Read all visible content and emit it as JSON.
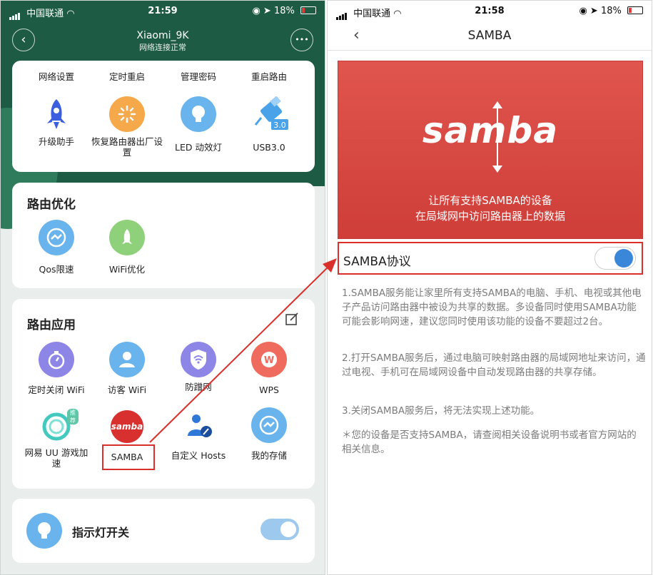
{
  "left": {
    "status": {
      "carrier": "中国联通",
      "time": "21:59",
      "battery": "18%"
    },
    "header": {
      "title": "Xiaomi_9K",
      "subtitle": "网络连接正常",
      "more": "•••",
      "back": "‹"
    },
    "top_labels": [
      "网络设置",
      "定时重启",
      "管理密码",
      "重启路由"
    ],
    "tools": [
      {
        "label": "升级助手",
        "icon": "rocket-icon"
      },
      {
        "label": "恢复路由器出厂设置",
        "icon": "reset-icon"
      },
      {
        "label": "LED 动效灯",
        "icon": "bulb-icon"
      },
      {
        "label": "USB3.0",
        "icon": "usb-icon",
        "badge": "3.0"
      }
    ],
    "optimize": {
      "title": "路由优化",
      "items": [
        {
          "label": "Qos限速",
          "icon": "speed-icon"
        },
        {
          "label": "WiFi优化",
          "icon": "wifi-rocket-icon"
        }
      ]
    },
    "apps": {
      "title": "路由应用",
      "items": [
        {
          "label": "定时关闭 WiFi",
          "icon": "timer-icon"
        },
        {
          "label": "访客 WiFi",
          "icon": "guest-icon"
        },
        {
          "label": "防蹭网",
          "icon": "shield-wifi-icon"
        },
        {
          "label": "WPS",
          "icon": "wps-icon"
        },
        {
          "label": "网易 UU 游戏加速",
          "icon": "uu-icon",
          "badge": "推荐"
        },
        {
          "label": "SAMBA",
          "icon": "samba-icon",
          "logo": "samba"
        },
        {
          "label": "自定义 Hosts",
          "icon": "hosts-icon"
        },
        {
          "label": "我的存储",
          "icon": "storage-icon"
        }
      ]
    },
    "indicator": {
      "label": "指示灯开关",
      "enabled": true
    }
  },
  "right": {
    "status": {
      "carrier": "中国联通",
      "time": "21:58",
      "battery": "18%"
    },
    "header": {
      "title": "SAMBA",
      "back": "‹"
    },
    "banner": {
      "logo": "samba",
      "line1": "让所有支持SAMBA的设备",
      "line2": "在局域网中访问路由器上的数据"
    },
    "setting": {
      "label": "SAMBA协议",
      "enabled": true
    },
    "paragraphs": [
      "1.SAMBA服务能让家里所有支持SAMBA的电脑、手机、电视或其他电子产品访问路由器中被设为共享的数据。多设备同时使用SAMBA功能可能会影响网速，建议您同时使用该功能的设备不要超过2台。",
      "2.打开SAMBA服务后，通过电脑可映射路由器的局域网地址来访问，通过电视、手机可在局域网设备中自动发现路由器的共享存储。",
      "3.关闭SAMBA服务后，将无法实现上述功能。",
      "＊您的设备是否支持SAMBA，请查阅相关设备说明书或者官方网站的相关信息。"
    ]
  },
  "colors": {
    "accent_red": "#d9302c",
    "toggle_blue": "#3a86d8",
    "header_green": "#1e5b44"
  }
}
